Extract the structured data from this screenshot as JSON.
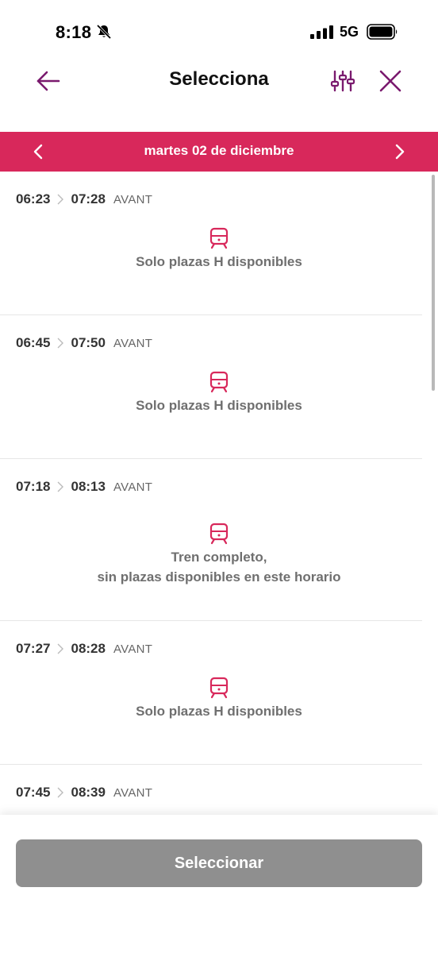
{
  "status_bar": {
    "time": "8:18",
    "network": "5G",
    "icons": [
      "bell-slash-icon",
      "signal-icon",
      "battery-icon"
    ]
  },
  "header": {
    "title": "Selecciona",
    "icons": [
      "arrow-left-icon",
      "sliders-icon",
      "close-icon"
    ],
    "accent_color": "#7a1a6e"
  },
  "date_bar": {
    "label": "martes 02 de diciembre",
    "background": "#d8285b"
  },
  "trains": [
    {
      "departure": "06:23",
      "arrival": "07:28",
      "type": "AVANT",
      "message": [
        "Solo plazas H disponibles"
      ]
    },
    {
      "departure": "06:45",
      "arrival": "07:50",
      "type": "AVANT",
      "message": [
        "Solo plazas H disponibles"
      ]
    },
    {
      "departure": "07:18",
      "arrival": "08:13",
      "type": "AVANT",
      "message": [
        "Tren completo,",
        "sin plazas disponibles en este horario"
      ]
    },
    {
      "departure": "07:27",
      "arrival": "08:28",
      "type": "AVANT",
      "message": [
        "Solo plazas H disponibles"
      ]
    },
    {
      "departure": "07:45",
      "arrival": "08:39",
      "type": "AVANT",
      "message": []
    }
  ],
  "footer": {
    "select_label": "Seleccionar"
  }
}
